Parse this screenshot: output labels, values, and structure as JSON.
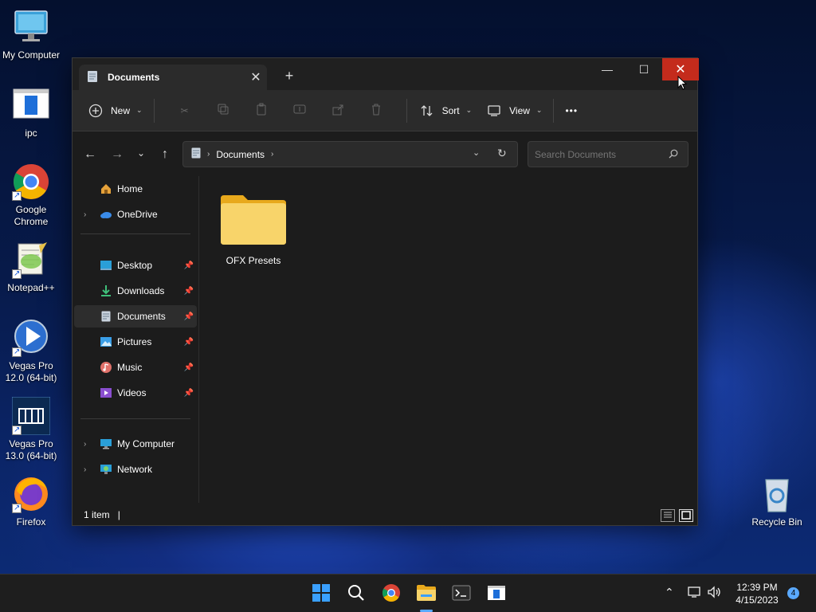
{
  "desktop": {
    "icons": [
      {
        "label": "My Computer"
      },
      {
        "label": "ipc"
      },
      {
        "label": "Google Chrome"
      },
      {
        "label": "Notepad++"
      },
      {
        "label": "Vegas Pro 12.0 (64-bit)"
      },
      {
        "label": "Vegas Pro 13.0 (64-bit)"
      },
      {
        "label": "Firefox"
      },
      {
        "label": "Recycle Bin"
      }
    ]
  },
  "window": {
    "tab_title": "Documents",
    "close_tab": "✕",
    "new_tab": "+",
    "minimize": "—",
    "maximize": "☐",
    "close": "✕"
  },
  "toolbar": {
    "new_label": "New",
    "sort_label": "Sort",
    "view_label": "View",
    "more": "•••"
  },
  "address": {
    "breadcrumb": "Documents",
    "search_placeholder": "Search Documents"
  },
  "sidebar": {
    "items": [
      {
        "label": "Home"
      },
      {
        "label": "OneDrive"
      },
      {
        "label": "Desktop"
      },
      {
        "label": "Downloads"
      },
      {
        "label": "Documents"
      },
      {
        "label": "Pictures"
      },
      {
        "label": "Music"
      },
      {
        "label": "Videos"
      },
      {
        "label": "My Computer"
      },
      {
        "label": "Network"
      }
    ]
  },
  "content": {
    "items": [
      {
        "label": "OFX Presets"
      }
    ]
  },
  "status": {
    "count": "1 item",
    "cursor": "|"
  },
  "taskbar": {
    "time": "12:39 PM",
    "date": "4/15/2023",
    "notifications": "4"
  }
}
